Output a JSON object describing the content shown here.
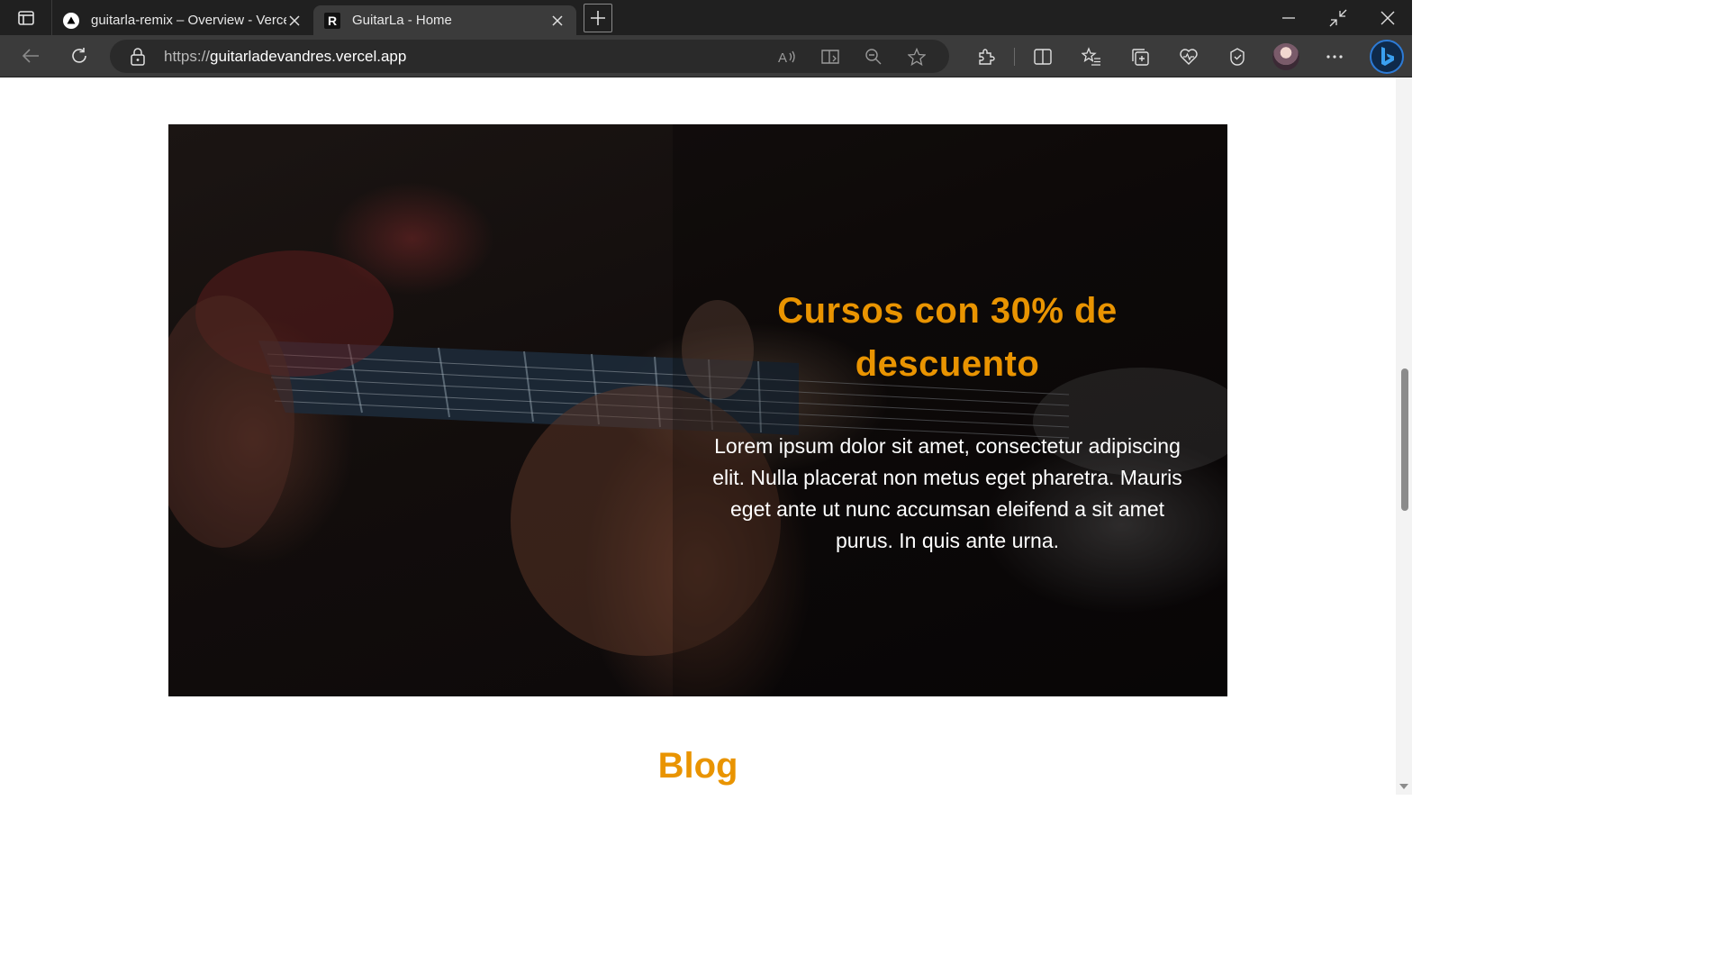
{
  "browser": {
    "tabs": [
      {
        "title": "guitarla-remix – Overview - Vercel",
        "favicon": "vercel-triangle-icon",
        "active": false
      },
      {
        "title": "GuitarLa - Home",
        "favicon": "remix-r-icon",
        "active": true
      }
    ],
    "url_scheme": "https://",
    "url_host": "guitarladevandres.vercel.app"
  },
  "page": {
    "hero": {
      "title": "Cursos con 30% de descuento",
      "text": "Lorem ipsum dolor sit amet, consectetur adipiscing elit. Nulla placerat non metus eget pharetra. Mauris eget ante ut nunc accumsan eleifend a sit amet purus. In quis ante urna."
    },
    "blog_heading": "Blog"
  },
  "colors": {
    "accent": "#e99401",
    "chrome_dark": "#202020",
    "chrome_toolbar": "#3b3b3b"
  }
}
